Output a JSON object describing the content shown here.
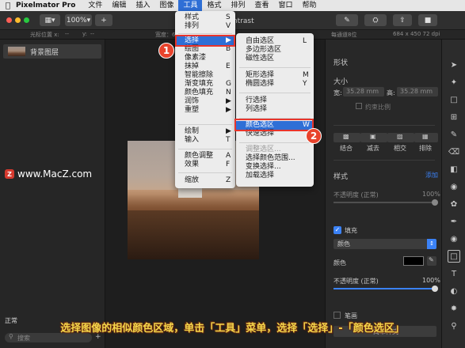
{
  "menubar": {
    "app_name": "Pixelmator Pro",
    "items": [
      "文件",
      "编辑",
      "插入",
      "图像",
      "工具",
      "格式",
      "排列",
      "查看",
      "窗口",
      "帮助"
    ],
    "active_item": "工具"
  },
  "toolbar": {
    "zoom": "100%",
    "add": "+",
    "doc_title": "rcontrast"
  },
  "infobar": {
    "cursor_label": "光标位置 x:",
    "cursor_x": "--",
    "cursor_y_label": "y:",
    "cursor_y": "--",
    "width_label": "宽度：684",
    "bit_depth": "每通道8位",
    "dimensions": "684 x 450 72 dpi"
  },
  "layers": {
    "items": [
      {
        "name": "背景图层"
      }
    ],
    "blend_mode": "正常",
    "search_placeholder": "搜索"
  },
  "tools_menu": {
    "items": [
      {
        "label": "样式",
        "shortcut": "S"
      },
      {
        "label": "排列",
        "shortcut": "V"
      },
      {
        "label": "选择",
        "shortcut": "",
        "submenu": true
      },
      {
        "label": "绘图",
        "shortcut": "B"
      },
      {
        "label": "像素漆",
        "shortcut": ""
      },
      {
        "label": "抹掉",
        "shortcut": "E"
      },
      {
        "label": "智能擦除",
        "shortcut": ""
      },
      {
        "label": "渐变填充",
        "shortcut": "G"
      },
      {
        "label": "颜色填充",
        "shortcut": "N"
      },
      {
        "label": "润饰",
        "shortcut": "",
        "submenu": true
      },
      {
        "label": "重塑",
        "shortcut": "",
        "submenu": true
      },
      {
        "label": "绘制",
        "shortcut": "",
        "submenu": true
      },
      {
        "label": "输入",
        "shortcut": "T"
      },
      {
        "label": "颜色调整",
        "shortcut": "A"
      },
      {
        "label": "效果",
        "shortcut": "F"
      },
      {
        "label": "缩放",
        "shortcut": "Z"
      }
    ],
    "highlighted": "选择"
  },
  "select_submenu": {
    "items": [
      {
        "label": "自由选区",
        "shortcut": "L"
      },
      {
        "label": "多边形选区",
        "shortcut": ""
      },
      {
        "label": "磁性选区",
        "shortcut": ""
      },
      {
        "label": "矩形选择",
        "shortcut": "M"
      },
      {
        "label": "椭圆选择",
        "shortcut": "Y"
      },
      {
        "label": "行选择",
        "shortcut": ""
      },
      {
        "label": "列选择",
        "shortcut": ""
      },
      {
        "label": "颜色选区",
        "shortcut": "W"
      },
      {
        "label": "快速选择",
        "shortcut": ""
      },
      {
        "label": "调整选区...",
        "shortcut": "",
        "disabled": true
      },
      {
        "label": "选择颜色范围...",
        "shortcut": ""
      },
      {
        "label": "变换选择...",
        "shortcut": ""
      },
      {
        "label": "加载选择",
        "shortcut": ""
      }
    ],
    "highlighted": "颜色选区"
  },
  "callouts": {
    "badge1": "1",
    "badge2": "2"
  },
  "sidebar": {
    "shape_label": "形状",
    "size_label": "大小",
    "width_label": "宽:",
    "width_value": "35.28 mm",
    "height_label": "高:",
    "height_value": "35.28 mm",
    "keep_ratio": "约束比例",
    "boolean_ops": [
      "结合",
      "减去",
      "相交",
      "排除"
    ],
    "style_label": "样式",
    "add_label": "添加",
    "opacity_label_1": "不透明度 (正常)",
    "opacity_value_1": "100%",
    "fill_label": "填充",
    "fill_checked": true,
    "fill_type": "颜色",
    "color_label": "颜色",
    "color_value": "#000000",
    "opacity_label_2": "不透明度 (正常)",
    "opacity_value_2": "100%",
    "opacity_fraction": 1.0,
    "stroke_label": "笔画",
    "bottom_button": "简单样式"
  },
  "watermark": {
    "text": "www.MacZ.com",
    "logo": "Z"
  },
  "caption": "选择图像的相似颜色区域，单击「工具」菜单，选择「选择」-「颜色选区」",
  "colors": {
    "accent": "#2f6fd6",
    "callout": "#e8352c",
    "caption": "#f4d64a"
  }
}
